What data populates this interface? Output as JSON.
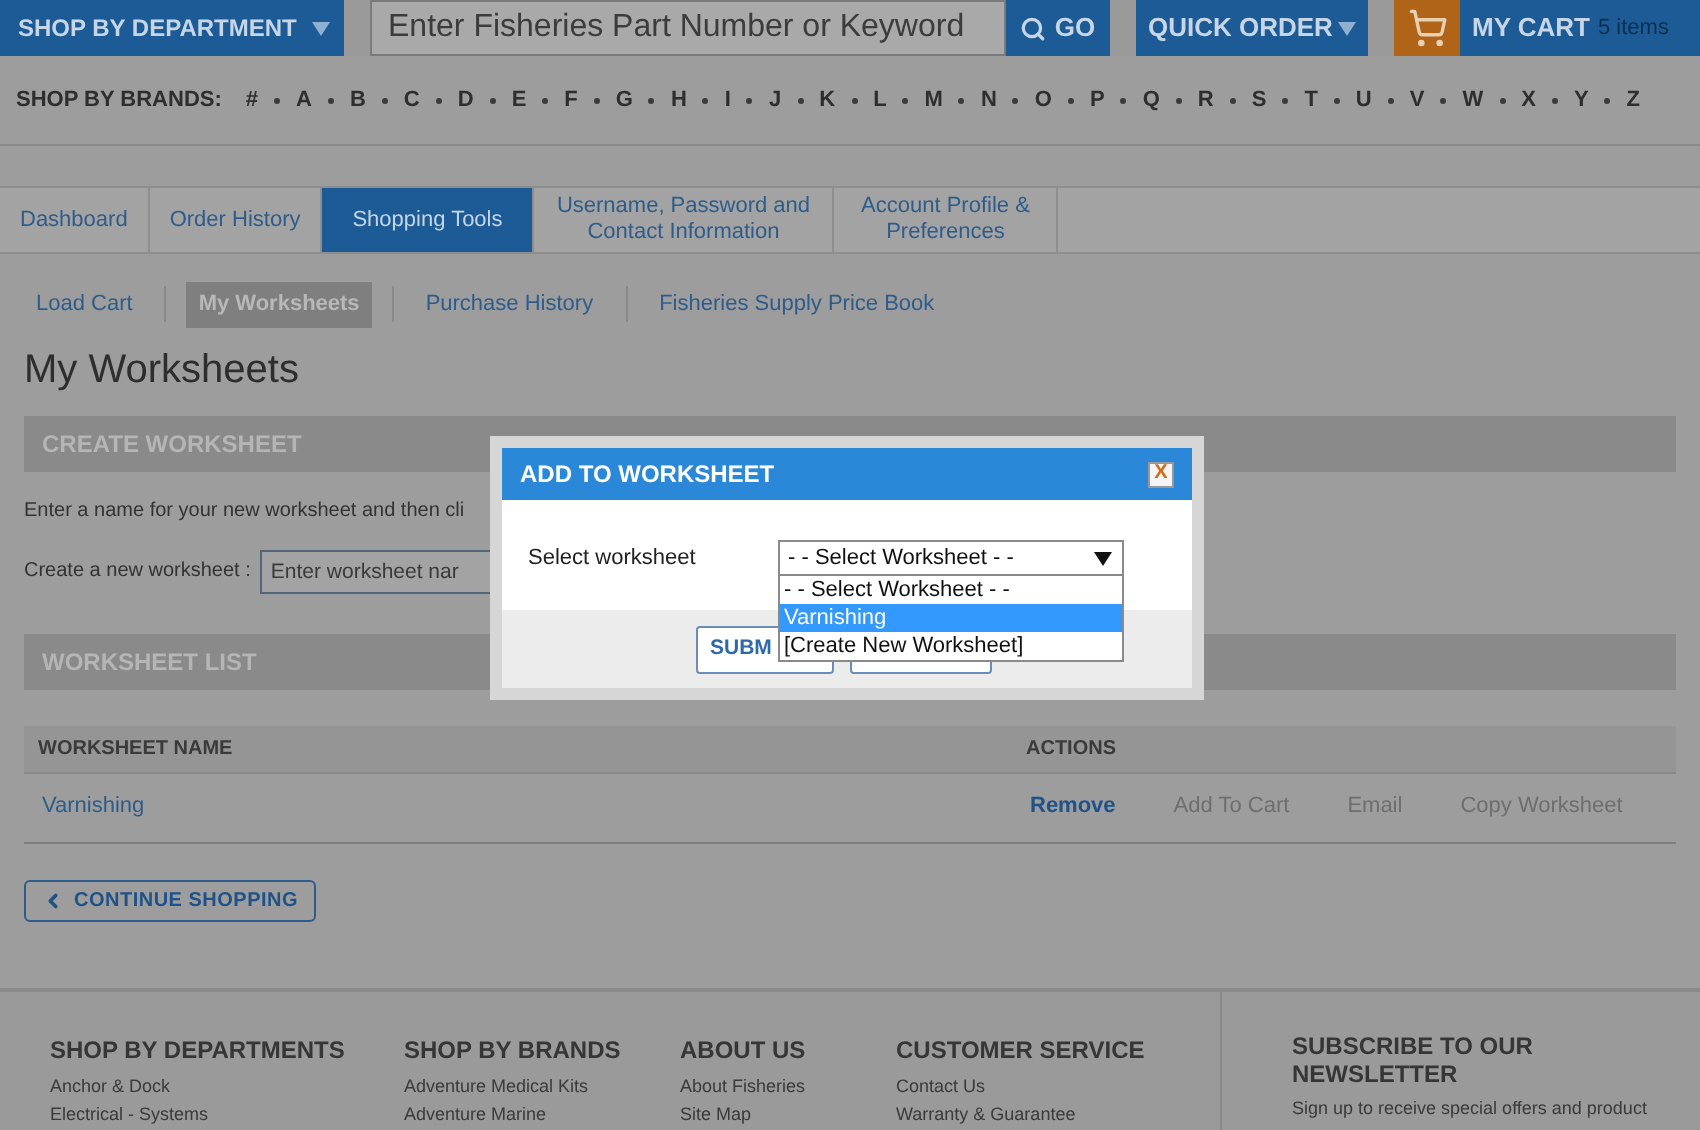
{
  "header": {
    "department_menu": "SHOP BY DEPARTMENT",
    "search": {
      "placeholder": "Enter Fisheries Part Number or Keyword",
      "button": "GO"
    },
    "quick_order": "QUICK ORDER",
    "cart": {
      "label": "MY CART",
      "count": "5 items"
    }
  },
  "brands": {
    "label": "SHOP BY BRANDS:",
    "letters": [
      "#",
      "A",
      "B",
      "C",
      "D",
      "E",
      "F",
      "G",
      "H",
      "I",
      "J",
      "K",
      "L",
      "M",
      "N",
      "O",
      "P",
      "Q",
      "R",
      "S",
      "T",
      "U",
      "V",
      "W",
      "X",
      "Y",
      "Z"
    ]
  },
  "tabs": [
    {
      "label": "Dashboard",
      "selected": false
    },
    {
      "label": "Order History",
      "selected": false
    },
    {
      "label": "Shopping Tools",
      "selected": true
    },
    {
      "label": "Username, Password and Contact Information",
      "selected": false
    },
    {
      "label": "Account Profile & Preferences",
      "selected": false
    }
  ],
  "subnav": [
    {
      "label": "Load Cart",
      "selected": false
    },
    {
      "label": "My Worksheets",
      "selected": true
    },
    {
      "label": "Purchase History",
      "selected": false
    },
    {
      "label": "Fisheries Supply Price Book",
      "selected": false
    }
  ],
  "page_title": "My Worksheets",
  "create_section": {
    "title": "CREATE WORKSHEET",
    "instructions": "Enter a name for your new worksheet and then cli",
    "field_label": "Create a new worksheet :",
    "field_placeholder": "Enter worksheet nar"
  },
  "list_section": {
    "title": "WORKSHEET LIST",
    "columns": [
      "WORKSHEET NAME",
      "ACTIONS"
    ],
    "rows": [
      {
        "name": "Varnishing",
        "actions": [
          {
            "label": "Remove",
            "kind": "primary"
          },
          {
            "label": "Add To Cart",
            "kind": "plain"
          },
          {
            "label": "Email",
            "kind": "plain"
          },
          {
            "label": "Copy Worksheet",
            "kind": "plain"
          }
        ]
      }
    ]
  },
  "continue_button": "CONTINUE SHOPPING",
  "footer": {
    "columns": [
      {
        "title": "SHOP BY DEPARTMENTS",
        "links": [
          "Anchor & Dock",
          "Electrical - Systems"
        ]
      },
      {
        "title": "SHOP BY BRANDS",
        "links": [
          "Adventure Medical Kits",
          "Adventure Marine"
        ]
      },
      {
        "title": "ABOUT US",
        "links": [
          "About Fisheries",
          "Site Map"
        ]
      },
      {
        "title": "CUSTOMER SERVICE",
        "links": [
          "Contact Us",
          "Warranty & Guarantee"
        ]
      }
    ],
    "newsletter": {
      "title": "SUBSCRIBE TO OUR NEWSLETTER",
      "text": "Sign up to receive special offers and product"
    }
  },
  "dialog": {
    "title": "ADD TO WORKSHEET",
    "close": "X",
    "label": "Select worksheet",
    "select_value": "- - Select Worksheet - -",
    "options": [
      {
        "label": "- - Select Worksheet - -",
        "selected": false
      },
      {
        "label": "Varnishing",
        "selected": true
      },
      {
        "label": "[Create New Worksheet]",
        "selected": false
      }
    ],
    "submit": "SUBM"
  }
}
